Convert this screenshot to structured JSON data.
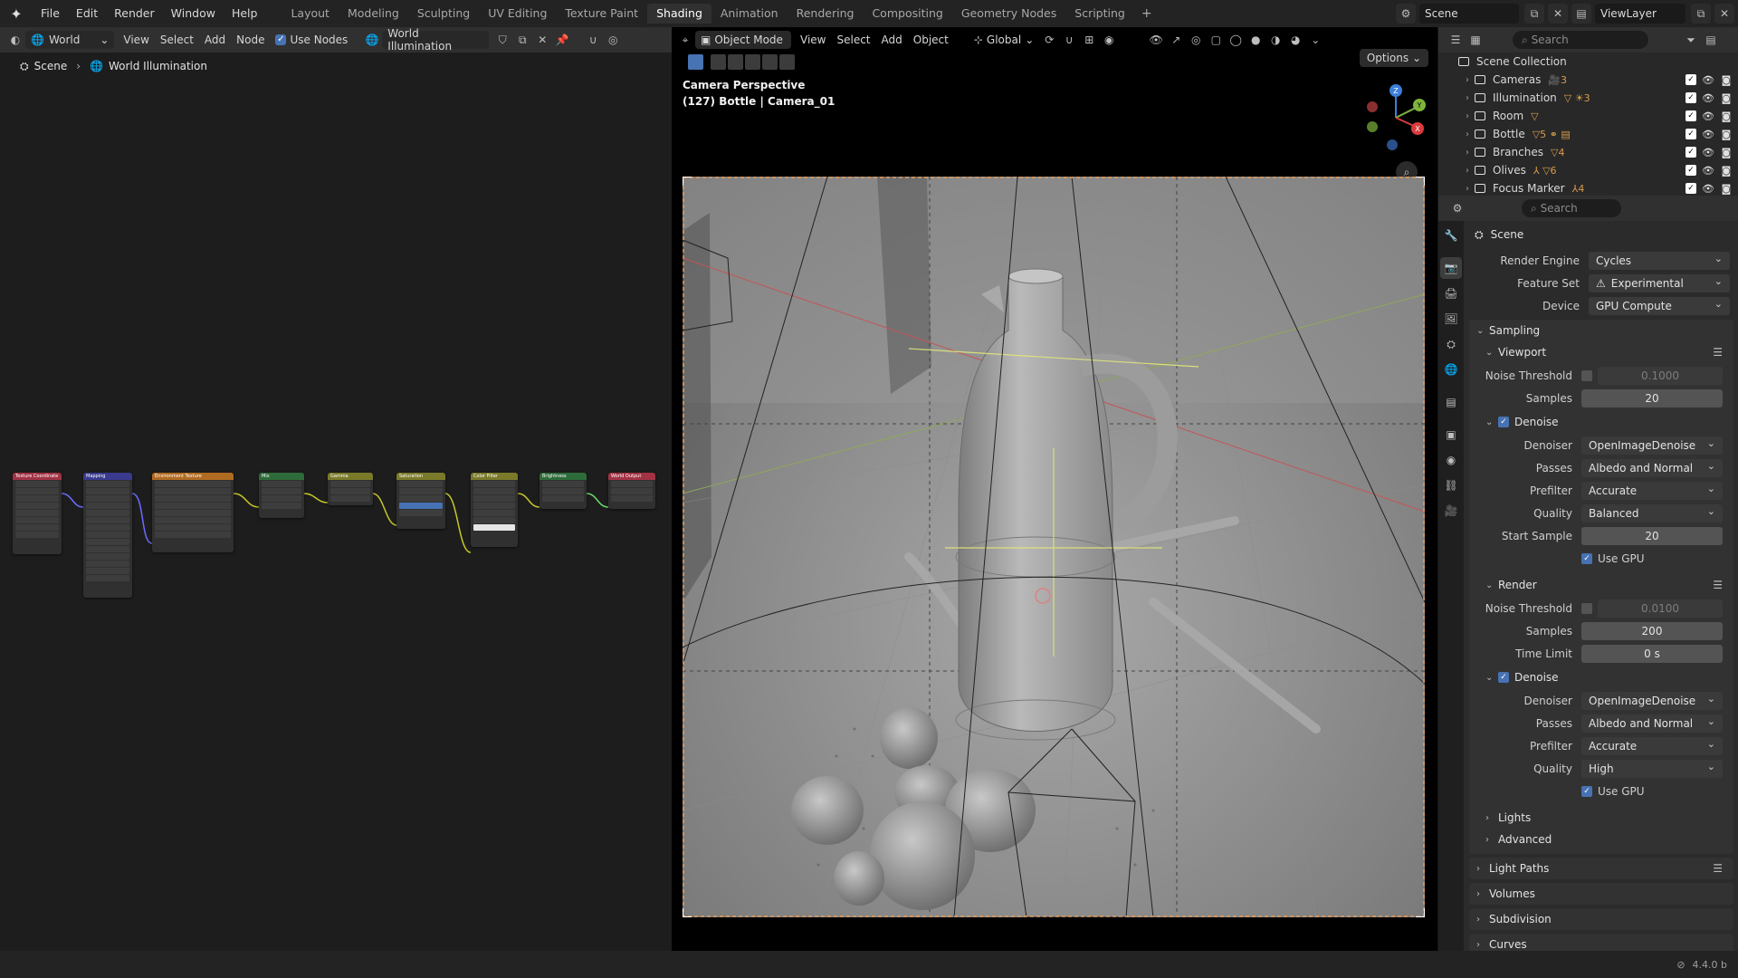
{
  "topbar": {
    "menus": [
      "File",
      "Edit",
      "Render",
      "Window",
      "Help"
    ],
    "workspaces": [
      "Layout",
      "Modeling",
      "Sculpting",
      "UV Editing",
      "Texture Paint",
      "Shading",
      "Animation",
      "Rendering",
      "Compositing",
      "Geometry Nodes",
      "Scripting"
    ],
    "active_workspace": "Shading",
    "add_tab": "+",
    "scene_name": "Scene",
    "view_layer": "ViewLayer"
  },
  "node_editor": {
    "world_type": "World",
    "menus": [
      "View",
      "Select",
      "Add",
      "Node"
    ],
    "use_nodes_label": "Use Nodes",
    "world_name": "World Illumination",
    "breadcrumb": [
      "Scene",
      "World Illumination"
    ],
    "nodes": [
      {
        "title": "Texture Coordinate",
        "color": "#a23244"
      },
      {
        "title": "Mapping",
        "color": "#3a3a8f"
      },
      {
        "title": "Environment Texture",
        "color": "#b06b22"
      },
      {
        "title": "Mix",
        "color": "#2e6b3a"
      },
      {
        "title": "Gamma",
        "color": "#7a7a2a"
      },
      {
        "title": "Saturation",
        "color": "#7a7a2a"
      },
      {
        "title": "Color Filter",
        "color": "#7a7a2a"
      },
      {
        "title": "Brightness",
        "color": "#2e6b3a"
      },
      {
        "title": "World Output",
        "color": "#a23244"
      }
    ]
  },
  "viewport": {
    "mode": "Object Mode",
    "menus": [
      "View",
      "Select",
      "Add",
      "Object"
    ],
    "transform": "Global",
    "options_label": "Options",
    "camera_title": "Camera Perspective",
    "camera_subtitle": "(127) Bottle | Camera_01"
  },
  "outliner": {
    "search_placeholder": "Search",
    "root": "Scene Collection",
    "collections": [
      {
        "name": "Cameras",
        "badge": "3"
      },
      {
        "name": "Illumination",
        "badge": "3"
      },
      {
        "name": "Room",
        "badge": ""
      },
      {
        "name": "Bottle",
        "badge": "5"
      },
      {
        "name": "Branches",
        "badge": "4"
      },
      {
        "name": "Olives",
        "badge": "6"
      },
      {
        "name": "Focus Marker",
        "badge": "4"
      }
    ]
  },
  "properties": {
    "search_placeholder": "Search",
    "context": "Scene",
    "render_engine_label": "Render Engine",
    "render_engine": "Cycles",
    "feature_set_label": "Feature Set",
    "feature_set": "Experimental",
    "device_label": "Device",
    "device": "GPU Compute",
    "sampling": {
      "title": "Sampling",
      "viewport": {
        "title": "Viewport",
        "noise_threshold_label": "Noise Threshold",
        "noise_threshold": "0.1000",
        "samples_label": "Samples",
        "samples": "20",
        "denoise": {
          "title": "Denoise",
          "denoiser_label": "Denoiser",
          "denoiser": "OpenImageDenoise",
          "passes_label": "Passes",
          "passes": "Albedo and Normal",
          "prefilter_label": "Prefilter",
          "prefilter": "Accurate",
          "quality_label": "Quality",
          "quality": "Balanced",
          "start_sample_label": "Start Sample",
          "start_sample": "20",
          "use_gpu_label": "Use GPU"
        }
      },
      "render": {
        "title": "Render",
        "noise_threshold_label": "Noise Threshold",
        "noise_threshold": "0.0100",
        "samples_label": "Samples",
        "samples": "200",
        "time_limit_label": "Time Limit",
        "time_limit": "0 s",
        "denoise": {
          "title": "Denoise",
          "denoiser_label": "Denoiser",
          "denoiser": "OpenImageDenoise",
          "passes_label": "Passes",
          "passes": "Albedo and Normal",
          "prefilter_label": "Prefilter",
          "prefilter": "Accurate",
          "quality_label": "Quality",
          "quality": "High",
          "use_gpu_label": "Use GPU"
        }
      },
      "lights": "Lights",
      "advanced": "Advanced"
    },
    "collapsed_panels": [
      "Light Paths",
      "Volumes",
      "Subdivision",
      "Curves"
    ]
  },
  "statusbar": {
    "version": "4.4.0 b"
  },
  "colors": {
    "accent": "#4772b3",
    "active_tab": "#303030"
  }
}
